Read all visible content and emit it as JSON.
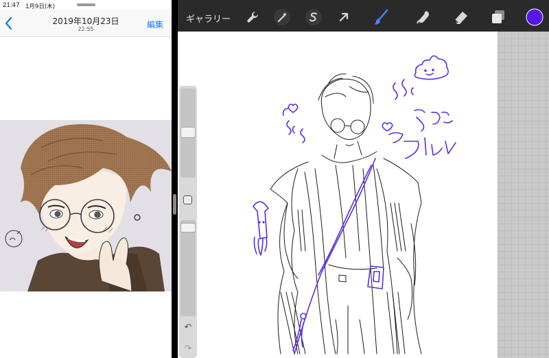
{
  "photos": {
    "status": {
      "time": "21:47",
      "date": "1月9日(木)"
    },
    "nav": {
      "date": "2019年10月23日",
      "time": "22:55",
      "edit_label": "編集",
      "back_icon": "chevron-left-icon"
    },
    "colors": {
      "accent": "#1a7cf5"
    }
  },
  "procreate": {
    "gallery_label": "ギャラリー",
    "tools": [
      "wrench-icon",
      "magic-wand-icon",
      "selection-icon",
      "transform-arrow-icon",
      "brush-icon",
      "smudge-icon",
      "eraser-icon",
      "layers-icon",
      "color-swatch"
    ],
    "current_color": "#5a16e6",
    "sidebar": {
      "modify_icon": "square-modify-icon",
      "undo_glyph": "↶",
      "redo_glyph": "↷"
    },
    "canvas": {
      "annotation_text": [
        "うんこ",
        "スメル"
      ]
    },
    "colors": {
      "toolbar_bg": "#2a2a2a",
      "active_tool": "#3d8bff",
      "sketch_ink": "#1a1a1a",
      "annotation_ink": "#5a2be0"
    }
  }
}
